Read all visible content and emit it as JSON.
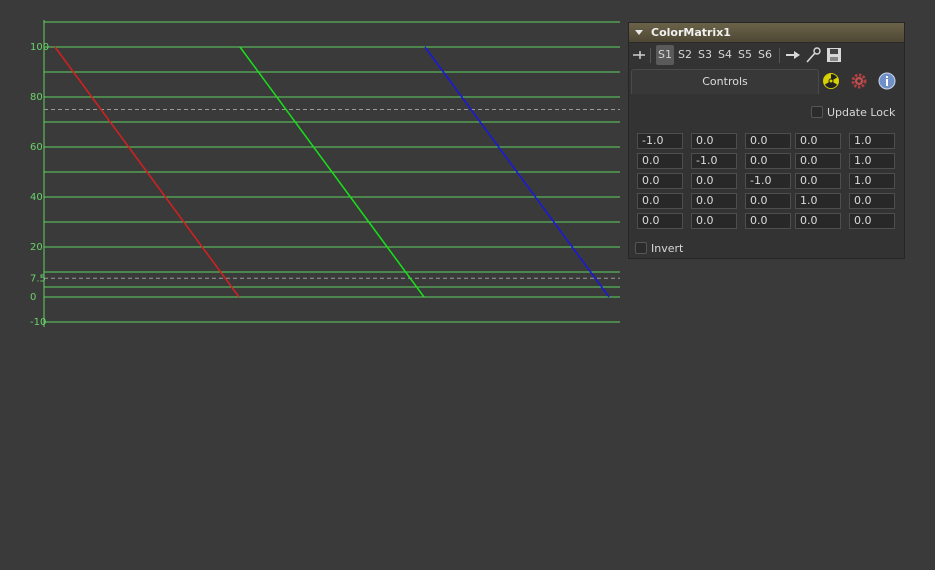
{
  "waveform": {
    "y_ticks": [
      "100",
      "80",
      "60",
      "40",
      "20",
      "7.5",
      "0",
      "-10"
    ],
    "colors": {
      "red": "#d42020",
      "green": "#18e018",
      "blue": "#1818e0",
      "grid": "#5fd35f",
      "ticks": "#6ad26a"
    }
  },
  "panel": {
    "title": "ColorMatrix1",
    "scenes": [
      "S1",
      "S2",
      "S3",
      "S4",
      "S5",
      "S6"
    ],
    "active_scene": "S1",
    "tab_label": "Controls",
    "update_lock_label": "Update Lock",
    "invert_label": "Invert",
    "matrix": [
      [
        "-1.0",
        "0.0",
        "0.0",
        "0.0",
        "1.0"
      ],
      [
        "0.0",
        "-1.0",
        "0.0",
        "0.0",
        "1.0"
      ],
      [
        "0.0",
        "0.0",
        "-1.0",
        "0.0",
        "1.0"
      ],
      [
        "0.0",
        "0.0",
        "0.0",
        "1.0",
        "0.0"
      ],
      [
        "0.0",
        "0.0",
        "0.0",
        "0.0",
        "0.0"
      ]
    ]
  }
}
